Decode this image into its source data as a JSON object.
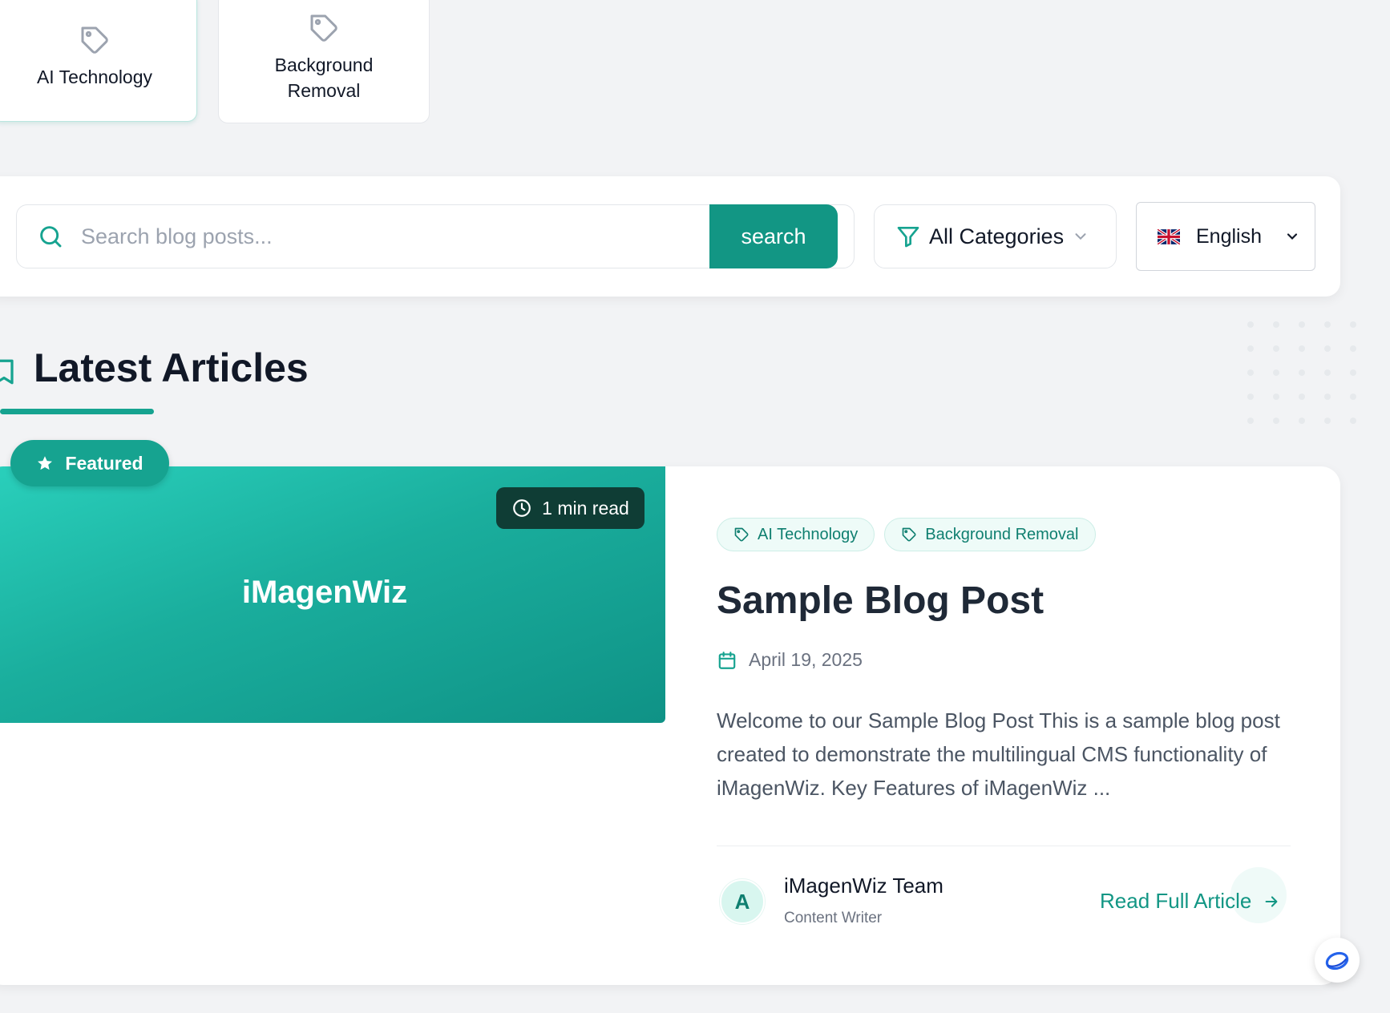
{
  "category_cards": [
    {
      "label": "AI Technology",
      "active": true
    },
    {
      "label_line1": "Background",
      "label_line2": "Removal",
      "active": false
    }
  ],
  "search": {
    "placeholder": "Search blog posts...",
    "button_label": "search"
  },
  "filters": {
    "category_selected": "All Categories",
    "language_selected": "English"
  },
  "section": {
    "title": "Latest Articles"
  },
  "article": {
    "featured_label": "Featured",
    "read_time": "1 min read",
    "hero_brand": "iMagenWiz",
    "tags": [
      "AI Technology",
      "Background Removal"
    ],
    "title": "Sample Blog Post",
    "date": "April 19, 2025",
    "excerpt": "Welcome to our Sample Blog Post This is a sample blog post created to demonstrate the multilingual CMS functionality of iMagenWiz. Key Features of iMagenWiz ...",
    "author": {
      "initial": "A",
      "name": "iMagenWiz Team",
      "role": "Content Writer"
    },
    "read_more_label": "Read Full Article"
  },
  "colors": {
    "accent": "#129684",
    "accent_light": "#2ad0bc",
    "background": "#f2f3f5",
    "badge_dark": "#0f3d35"
  }
}
